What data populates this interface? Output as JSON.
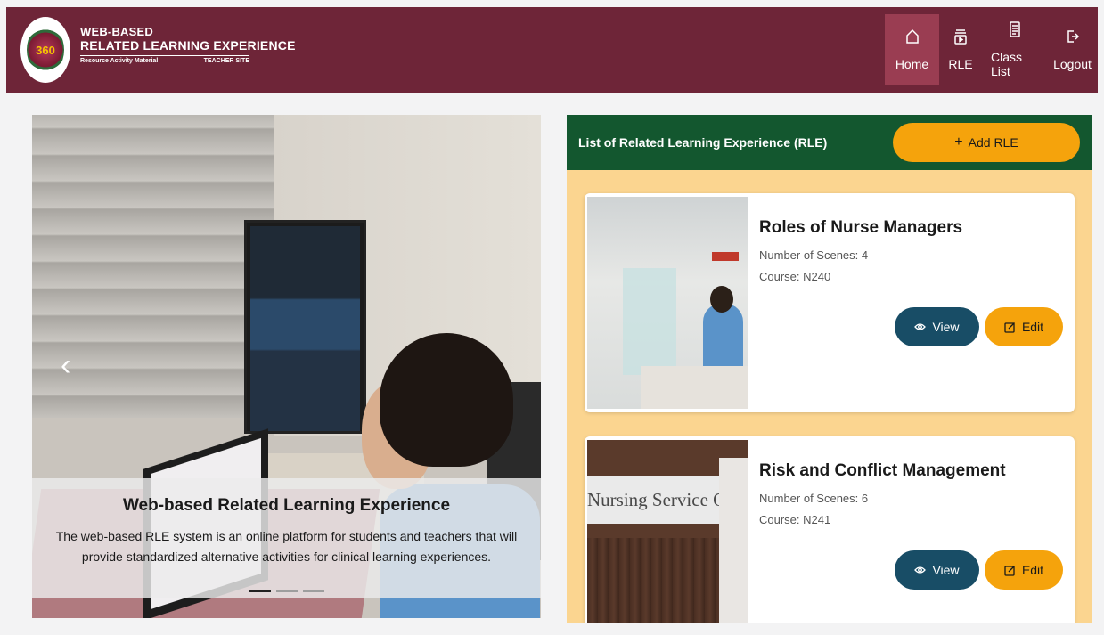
{
  "header": {
    "brand_line1": "WEB-BASED",
    "brand_line2": "RELATED LEARNING EXPERIENCE",
    "brand_sub_left": "Resource Activity Material",
    "brand_sub_right": "TEACHER SITE",
    "logo_text": "360",
    "nav": [
      {
        "label": "Home",
        "icon": "home-icon",
        "active": true
      },
      {
        "label": "RLE",
        "icon": "rle-icon",
        "active": false
      },
      {
        "label": "Class List",
        "icon": "class-list-icon",
        "active": false
      },
      {
        "label": "Logout",
        "icon": "logout-icon",
        "active": false
      }
    ]
  },
  "carousel": {
    "caption_title": "Web-based Related Learning Experience",
    "caption_text": "The web-based RLE system is an online platform for students and teachers that will provide standardized alternative activities for clinical learning experiences.",
    "prev_arrow": "‹",
    "slide_count": 3,
    "active_slide": 1
  },
  "panel": {
    "title": "List of Related Learning Experience (RLE)",
    "add_label": "Add RLE",
    "cards": [
      {
        "title": "Roles of Nurse Managers",
        "scenes": "Number of Scenes: 4",
        "course": "Course: N240",
        "view_label": "View",
        "edit_label": "Edit"
      },
      {
        "title": "Risk and Conflict Management",
        "scenes": "Number of Scenes: 6",
        "course": "Course: N241",
        "view_label": "View",
        "edit_label": "Edit",
        "thumb_sign": "Nursing Service Office"
      }
    ]
  },
  "colors": {
    "header_bg": "#6e2538",
    "nav_active_bg": "#9a3d52",
    "panel_head_bg": "#13572f",
    "panel_bg": "#fbd590",
    "accent_orange": "#f5a30c",
    "view_btn_bg": "#184d66"
  }
}
